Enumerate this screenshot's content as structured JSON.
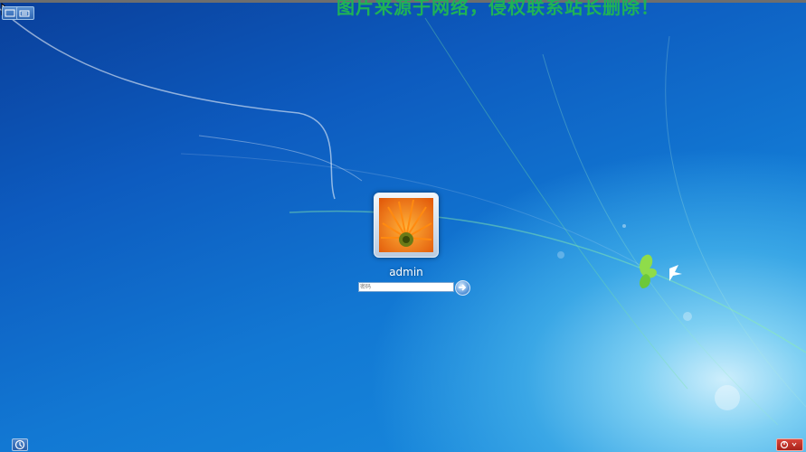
{
  "screen": {
    "type": "windows-logon"
  },
  "watermark": "图片来源于网络，侵权联系站长删除！",
  "toolbar": {
    "icons": [
      "pointer-cursor-icon",
      "small-window-icon",
      "keyboard-icon"
    ]
  },
  "user": {
    "name": "admin",
    "picture": "orange-flower-avatar"
  },
  "password": {
    "placeholder": "密码",
    "value": ""
  },
  "buttons": {
    "submit": "arrow-right-icon",
    "ease_of_access": "ease-of-access-icon",
    "power": "power-icon"
  },
  "colors": {
    "accent": "#1278d3",
    "power": "#c8322a",
    "watermark": "#1fb257"
  }
}
